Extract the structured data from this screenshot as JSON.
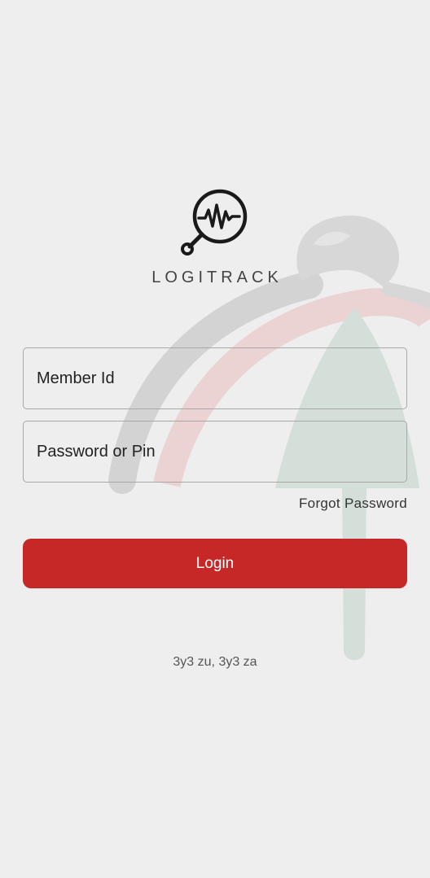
{
  "app": {
    "brand_name": "LOGITRACK",
    "logo_icon": "magnifier-heartbeat-icon"
  },
  "login_form": {
    "member_id_placeholder": "Member Id",
    "member_id_value": "",
    "password_placeholder": "Password or Pin",
    "password_value": "",
    "forgot_password_label": "Forgot Password",
    "login_label": "Login"
  },
  "footer": {
    "tagline": "3y3 zu, 3y3 za"
  },
  "colors": {
    "background": "#eeeeee",
    "primary_button": "#c62828",
    "field_border": "#a8a8a8"
  }
}
